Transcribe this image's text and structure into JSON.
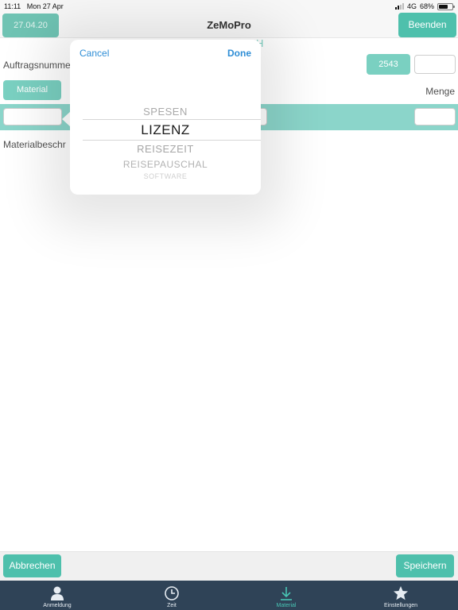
{
  "status_bar": {
    "time": "11:11",
    "date": "Mon 27 Apr",
    "network": "4G",
    "battery": "68%",
    "battery_level": 0.68
  },
  "nav": {
    "date_button": "27.04.20",
    "title": "ZeMoPro",
    "end_button": "Beenden"
  },
  "form": {
    "order_label": "Auftragsnumme",
    "order_number_button": "2543",
    "order_field_value": "",
    "material_button": "Material",
    "quantity_label": "Menge",
    "material_field_value": "",
    "quantity_field_value": "",
    "description_label": "Materialbeschr",
    "behind_text": "H"
  },
  "picker": {
    "cancel_label": "Cancel",
    "done_label": "Done",
    "items": [
      {
        "label": "SPESEN"
      },
      {
        "label": "LIZENZ"
      },
      {
        "label": "REISEZEIT"
      },
      {
        "label": "REISEPAUSCHAL"
      },
      {
        "label": "SOFTWARE"
      }
    ],
    "selected_index": 1
  },
  "actions": {
    "cancel_button": "Abbrechen",
    "save_button": "Speichern"
  },
  "tabs": [
    {
      "label": "Anmeldung",
      "icon": "person-icon",
      "active": false
    },
    {
      "label": "Zeit",
      "icon": "clock-icon",
      "active": false
    },
    {
      "label": "Material",
      "icon": "download-icon",
      "active": true
    },
    {
      "label": "Einstellungen",
      "icon": "star-icon",
      "active": false
    }
  ],
  "colors": {
    "accent": "#4ec0ac",
    "material_bar": "#64c7b8",
    "tab_bar": "#2f4357",
    "tab_active": "#48c4b3",
    "link_blue": "#2f8ed6"
  }
}
